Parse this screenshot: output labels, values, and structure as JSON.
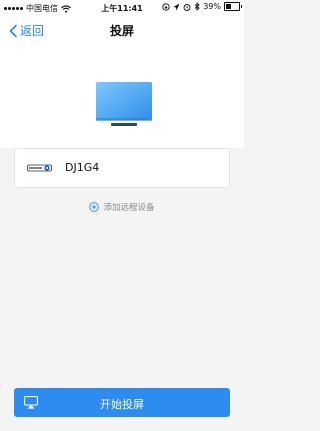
{
  "status_bar": {
    "carrier": "中国电信",
    "time": "上午11:41",
    "battery_percent": "39%",
    "battery_level": 0.39
  },
  "nav": {
    "back_label": "返回",
    "title": "投屏"
  },
  "device": {
    "name": "DJ1G4"
  },
  "add_remote": {
    "label": "添加远程设备"
  },
  "start_button": {
    "label": "开始投屏"
  },
  "colors": {
    "accent": "#2d8cf0",
    "link": "#2b87f2",
    "background": "#f4f4f5"
  },
  "icons": [
    "signal-icon",
    "wifi-icon",
    "lock-rotation-icon",
    "location-icon",
    "alarm-icon",
    "bluetooth-icon",
    "battery-icon",
    "back-chevron-icon",
    "tv-icon",
    "device-icon",
    "add-circle-icon",
    "airplay-icon"
  ]
}
